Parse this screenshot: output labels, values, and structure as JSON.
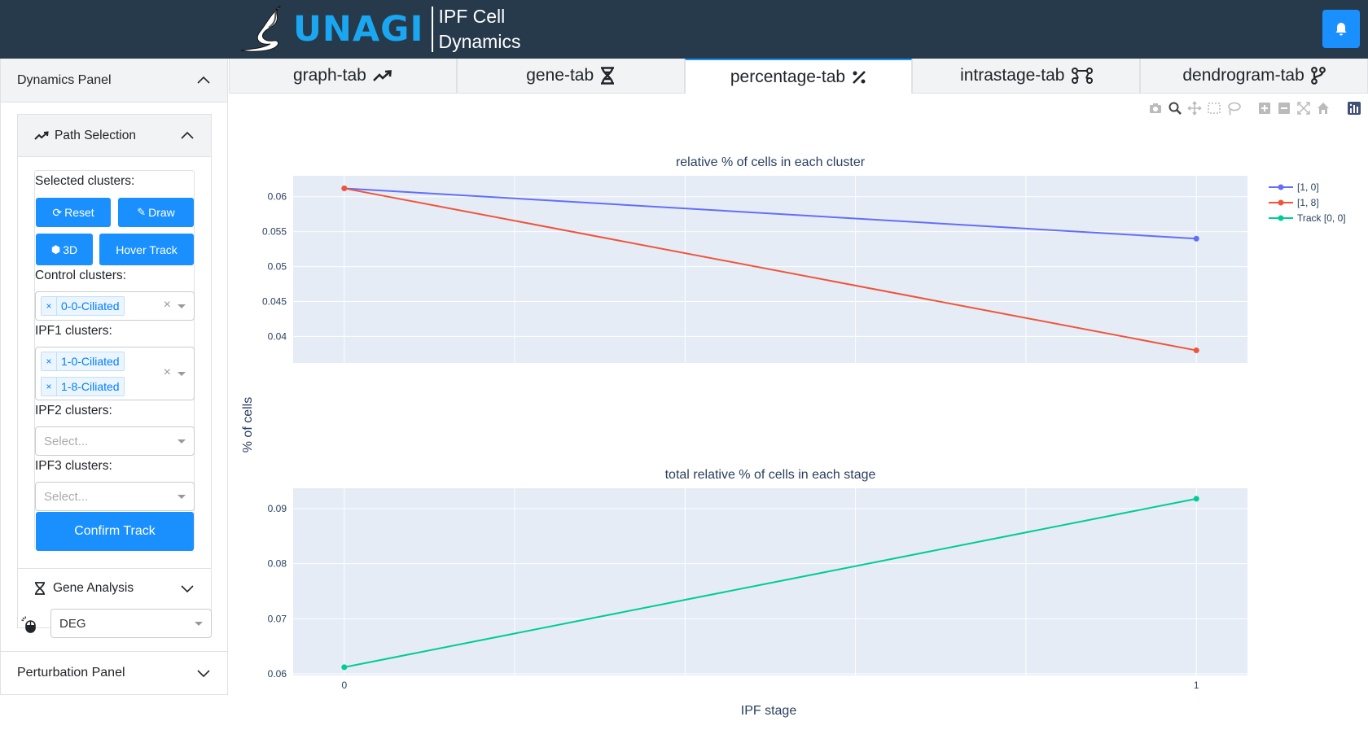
{
  "header": {
    "brand": "UNAGI",
    "subtitle_line1": "IPF Cell",
    "subtitle_line2": "Dynamics"
  },
  "sidebar": {
    "dynamics_panel": "Dynamics Panel",
    "path_selection": "Path Selection",
    "selected_clusters_label": "Selected clusters:",
    "reset_label": "Reset",
    "draw_label": "Draw",
    "three_d_label": "3D",
    "hover_track_label": "Hover Track",
    "control_clusters_label": "Control clusters:",
    "control_tags": [
      "0-0-Ciliated"
    ],
    "ipf1_clusters_label": "IPF1 clusters:",
    "ipf1_tags": [
      "1-0-Ciliated",
      "1-8-Ciliated"
    ],
    "ipf2_clusters_label": "IPF2 clusters:",
    "ipf2_placeholder": "Select...",
    "ipf3_clusters_label": "IPF3 clusters:",
    "ipf3_placeholder": "Select...",
    "confirm_track_label": "Confirm Track",
    "gene_analysis": "Gene Analysis",
    "deg_value": "DEG",
    "perturbation_panel": "Perturbation Panel"
  },
  "tabs": [
    {
      "label": "graph-tab",
      "icon": "chart-line-icon",
      "active": false
    },
    {
      "label": "gene-tab",
      "icon": "dna-icon",
      "active": false
    },
    {
      "label": "percentage-tab",
      "icon": "percent-icon",
      "active": true
    },
    {
      "label": "intrastage-tab",
      "icon": "diagram-icon",
      "active": false
    },
    {
      "label": "dendrogram-tab",
      "icon": "code-branch-icon",
      "active": false
    }
  ],
  "colors": {
    "header_bg": "#273a4b",
    "brand_blue": "#1aa6f0",
    "primary_button": "#1a90ff",
    "series_1_0": "#636efa",
    "series_1_8": "#ef553b",
    "series_track": "#00cc96",
    "plot_bg": "#e5ecf6"
  },
  "chart_data": [
    {
      "type": "line",
      "title": "relative % of cells in each cluster",
      "x": [
        0,
        1
      ],
      "series": [
        {
          "name": "[1, 0]",
          "values": [
            0.0612,
            0.054
          ]
        },
        {
          "name": "[1, 8]",
          "values": [
            0.0612,
            0.038
          ]
        }
      ],
      "ylim": [
        0.0362,
        0.063
      ],
      "yticks": [
        0.04,
        0.045,
        0.05,
        0.055,
        0.06
      ],
      "ytick_labels": [
        "0.04",
        "0.045",
        "0.05",
        "0.055",
        "0.06"
      ],
      "xlim": [
        -0.06,
        1.06
      ]
    },
    {
      "type": "line",
      "title": "total relative % of cells in each stage",
      "x": [
        0,
        1
      ],
      "series": [
        {
          "name": "Track [0, 0]",
          "values": [
            0.0612,
            0.0918
          ]
        }
      ],
      "ylim": [
        0.0597,
        0.0937
      ],
      "yticks": [
        0.06,
        0.07,
        0.08,
        0.09
      ],
      "ytick_labels": [
        "0.06",
        "0.07",
        "0.08",
        "0.09"
      ],
      "xlim": [
        -0.06,
        1.06
      ],
      "xtick_labels": [
        "0",
        "1"
      ]
    }
  ],
  "axes": {
    "ylabel": "% of cells",
    "xlabel": "IPF stage"
  },
  "legend": {
    "placement": "top-right",
    "entries": [
      "[1, 0]",
      "[1, 8]",
      "Track [0, 0]"
    ]
  }
}
